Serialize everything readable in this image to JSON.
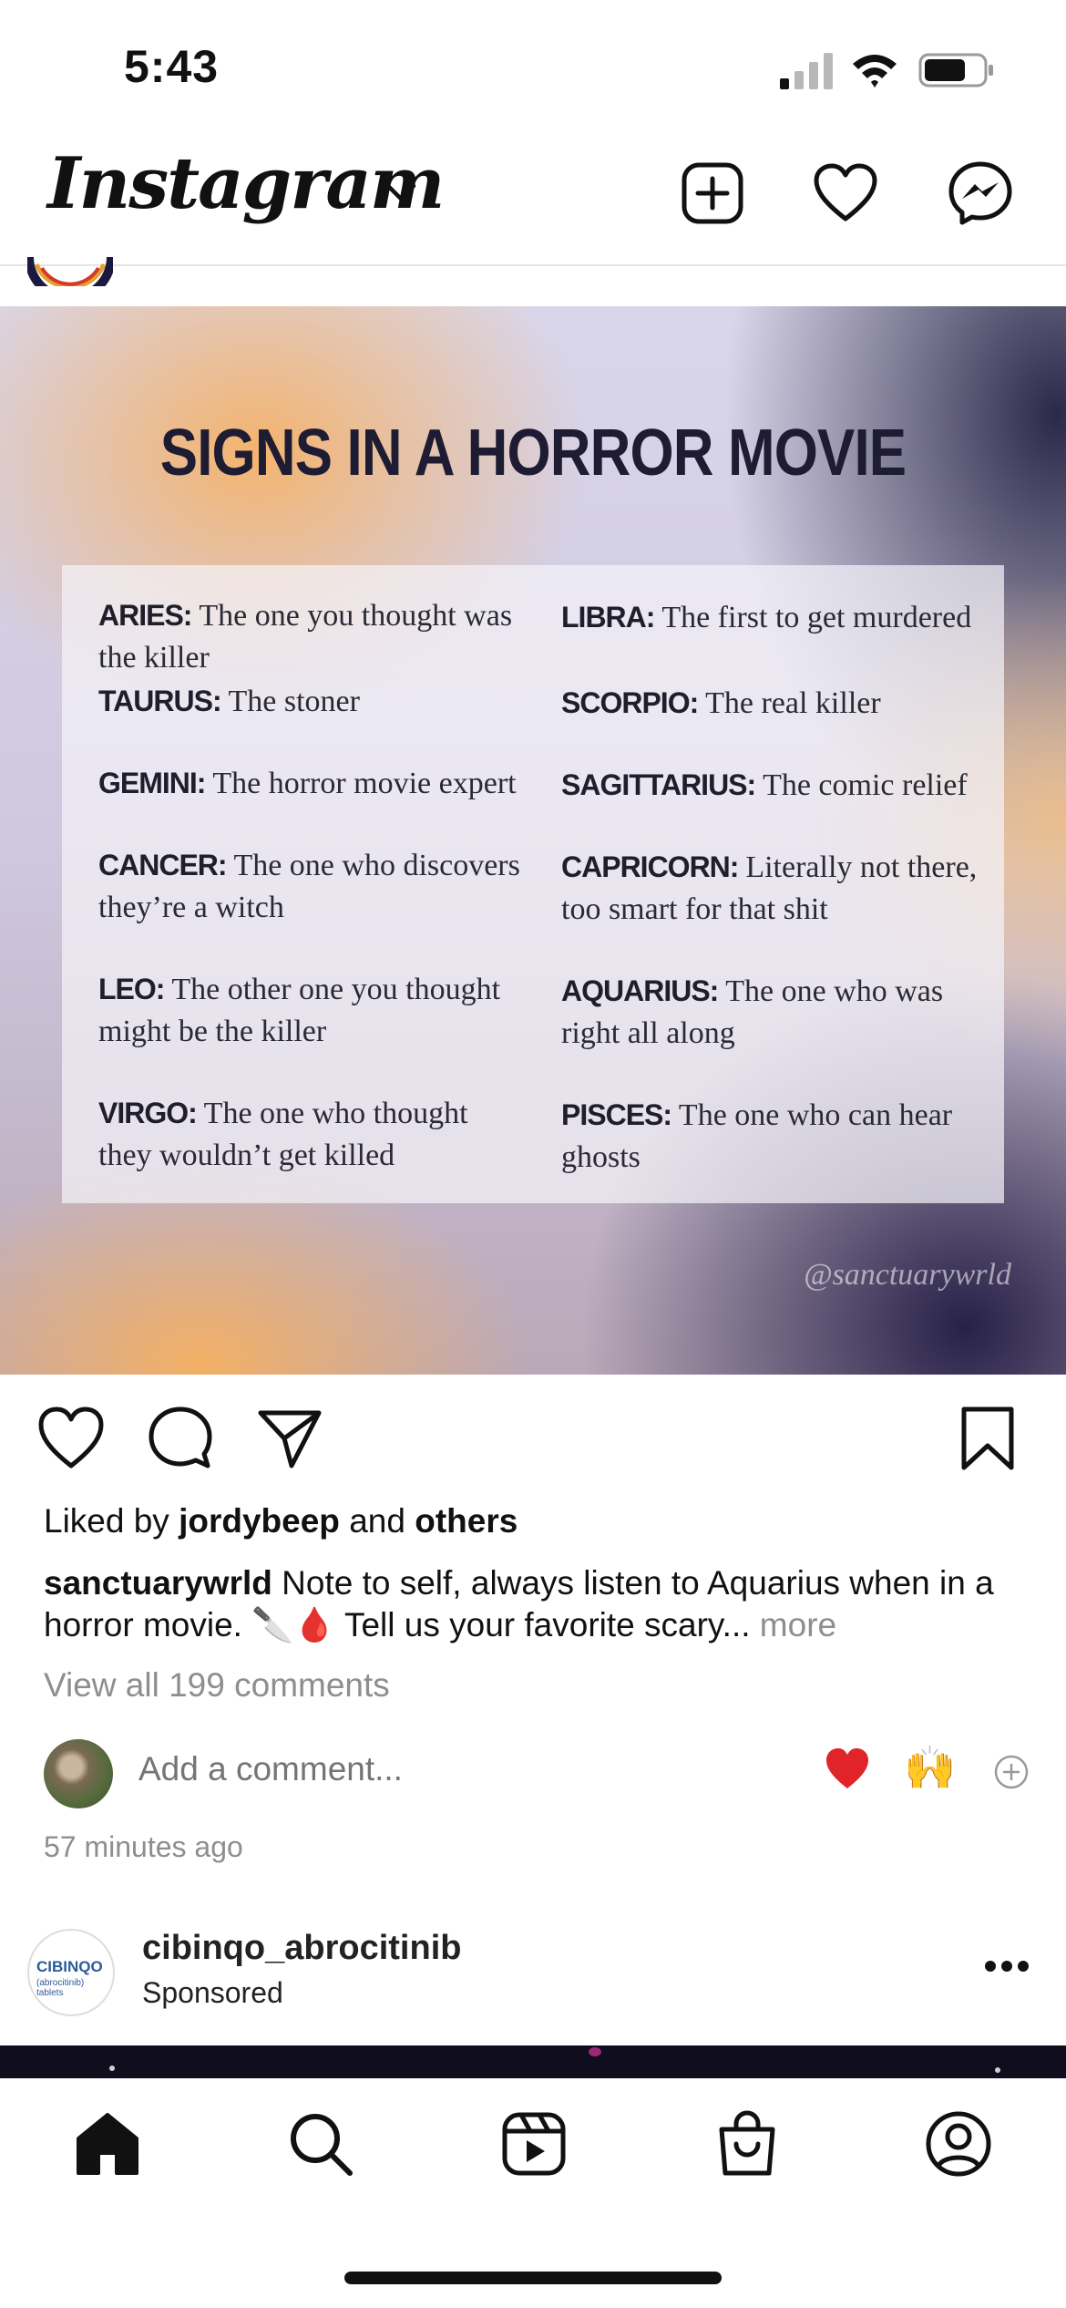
{
  "status_bar": {
    "time": "5:43"
  },
  "header": {
    "logo_text": "Instagram"
  },
  "post": {
    "image": {
      "title": "SIGNS IN A HORROR MOVIE",
      "signs": [
        {
          "name": "ARIES",
          "text": "The one you thought was the killer"
        },
        {
          "name": "LIBRA",
          "text": "The first to get murdered"
        },
        {
          "name": "TAURUS",
          "text": "The stoner"
        },
        {
          "name": "SCORPIO",
          "text": "The real killer"
        },
        {
          "name": "GEMINI",
          "text": "The horror movie expert"
        },
        {
          "name": "SAGITTARIUS",
          "text": "The comic relief"
        },
        {
          "name": "CANCER",
          "text": "The one who discovers they’re a witch"
        },
        {
          "name": "CAPRICORN",
          "text": "Literally not there, too smart for that shit"
        },
        {
          "name": "LEO",
          "text": "The other one you thought might be the killer"
        },
        {
          "name": "AQUARIUS",
          "text": "The one who was right all along"
        },
        {
          "name": "VIRGO",
          "text": "The one who thought they wouldn’t get killed"
        },
        {
          "name": "PISCES",
          "text": "The one who can hear ghosts"
        }
      ],
      "watermark": "@sanctuarywrld"
    },
    "likes": {
      "prefix": "Liked by ",
      "user": "jordybeep",
      "middle": " and ",
      "others": "others"
    },
    "caption": {
      "username": "sanctuarywrld",
      "text": " Note to self, always listen to Aquarius when in a horror movie. 🔪🩸 Tell us your favorite scary...",
      "more": " more"
    },
    "view_comments": "View all 199 comments",
    "comment_placeholder": "Add a comment...",
    "quick_emojis": {
      "heart": "heart-emoji",
      "hands": "🙌"
    },
    "time_ago": "57 minutes ago"
  },
  "next_post": {
    "username": "cibinqo_abrocitinib",
    "label": "Sponsored",
    "avatar_logo": "CIBINQO",
    "avatar_sub": "(abrocitinib) tablets"
  },
  "tab_bar": {
    "items": [
      "home-icon",
      "search-icon",
      "reels-icon",
      "shop-icon",
      "profile-icon"
    ]
  },
  "colors": {
    "text": "#111111",
    "muted": "#8e8e8e",
    "like_red": "#e0242a"
  }
}
